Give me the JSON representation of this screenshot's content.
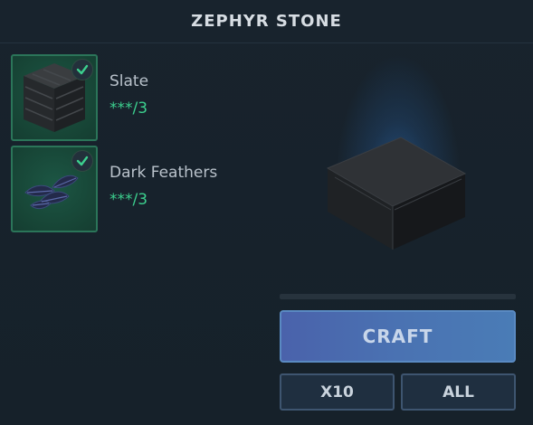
{
  "title": "ZEPHYR STONE",
  "ingredients": [
    {
      "name": "Slate",
      "count": "***/3",
      "icon": "slate-block-icon",
      "status": "check-icon"
    },
    {
      "name": "Dark Feathers",
      "count": "***/3",
      "icon": "dark-feathers-icon",
      "status": "check-icon"
    }
  ],
  "preview": {
    "icon": "zephyr-stone-block-icon"
  },
  "actions": {
    "craft": "CRAFT",
    "x10": "X10",
    "all": "ALL"
  },
  "progress": 0,
  "colors": {
    "background": "#162029",
    "slot_border": "#2b7559",
    "count_green": "#3ccf8e",
    "craft_button": "#4a6cb0"
  }
}
